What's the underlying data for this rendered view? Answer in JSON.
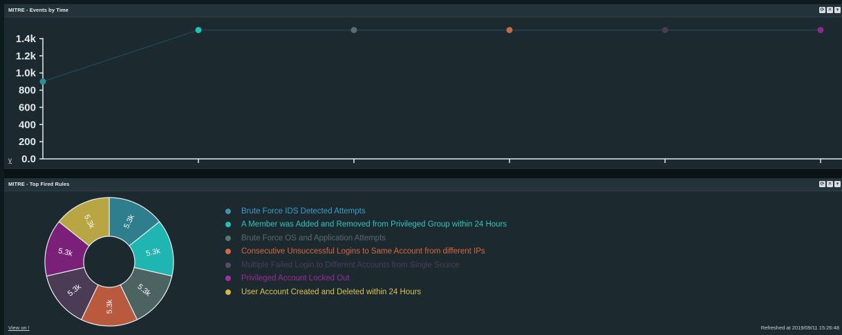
{
  "top_panel": {
    "title": "MITRE - Events by Time",
    "buttons": [
      "refresh-icon",
      "close-icon",
      "menu-icon"
    ]
  },
  "chart_data": {
    "type": "line",
    "x": [
      0,
      1,
      2,
      3,
      4,
      5
    ],
    "values": [
      900,
      1500,
      1500,
      1500,
      1500,
      1500
    ],
    "point_colors": [
      "#2a8f96",
      "#1ec2b5",
      "#5a6a6d",
      "#c56a47",
      "#4a3a54",
      "#8a2a8a"
    ],
    "y_ticks": [
      "0.0",
      "200",
      "400",
      "600",
      "800",
      "1.0k",
      "1.2k",
      "1.4k"
    ],
    "y_tick_values": [
      0,
      200,
      400,
      600,
      800,
      1000,
      1200,
      1400
    ],
    "ylim": [
      0,
      1560
    ],
    "ylabel": "y",
    "xlabel": "",
    "x_tick_labels": [
      "",
      "",
      "",
      "",
      ""
    ],
    "grid": false,
    "line_color": "#23434f"
  },
  "bottom_panel": {
    "title": "MITRE - Top Fired Rules",
    "view_link": "View on !",
    "refreshed": "Refreshed at  2019/09/11 15:26:48"
  },
  "pie_data": {
    "type": "pie",
    "slices": [
      {
        "label": "Brute Force IDS Detected Attempts",
        "value": 5300,
        "text": "5.3k",
        "color": "#2e7e8e",
        "legend_color": "#4a8fa8"
      },
      {
        "label": "A Member was Added and Removed from Privileged Group within 24 Hours",
        "value": 5300,
        "text": "5.3k",
        "color": "#1fb5b0",
        "legend_color": "#22c0b8"
      },
      {
        "label": "Brute Force OS and Application Attempts",
        "value": 5300,
        "text": "5.3k",
        "color": "#4d6362",
        "legend_color": "#5d7374"
      },
      {
        "label": "Consecutive Unsuccessful Logins to Same Account from different IPs",
        "value": 5300,
        "text": "5.3k",
        "color": "#b9593d",
        "legend_color": "#d06a4a"
      },
      {
        "label": "Multiple Failed Login to Different Accounts from Single Source",
        "value": 5300,
        "text": "5.3k",
        "color": "#4b3b54",
        "legend_color": "#5a4a63"
      },
      {
        "label": "Privileged Account Locked Out",
        "value": 5300,
        "text": "5.3k",
        "color": "#7a2078",
        "legend_color": "#a030a0"
      },
      {
        "label": "User Account Created and Deleted within 24 Hours",
        "value": 5300,
        "text": "5.3k",
        "color": "#b8a645",
        "legend_color": "#d2b845"
      }
    ]
  },
  "legend": {
    "text_colors": [
      "#3b9cc9",
      "#2ec4be",
      "#5a6a6c",
      "#d8673f",
      "#4c3f55",
      "#9a2a98",
      "#d9c055"
    ]
  }
}
